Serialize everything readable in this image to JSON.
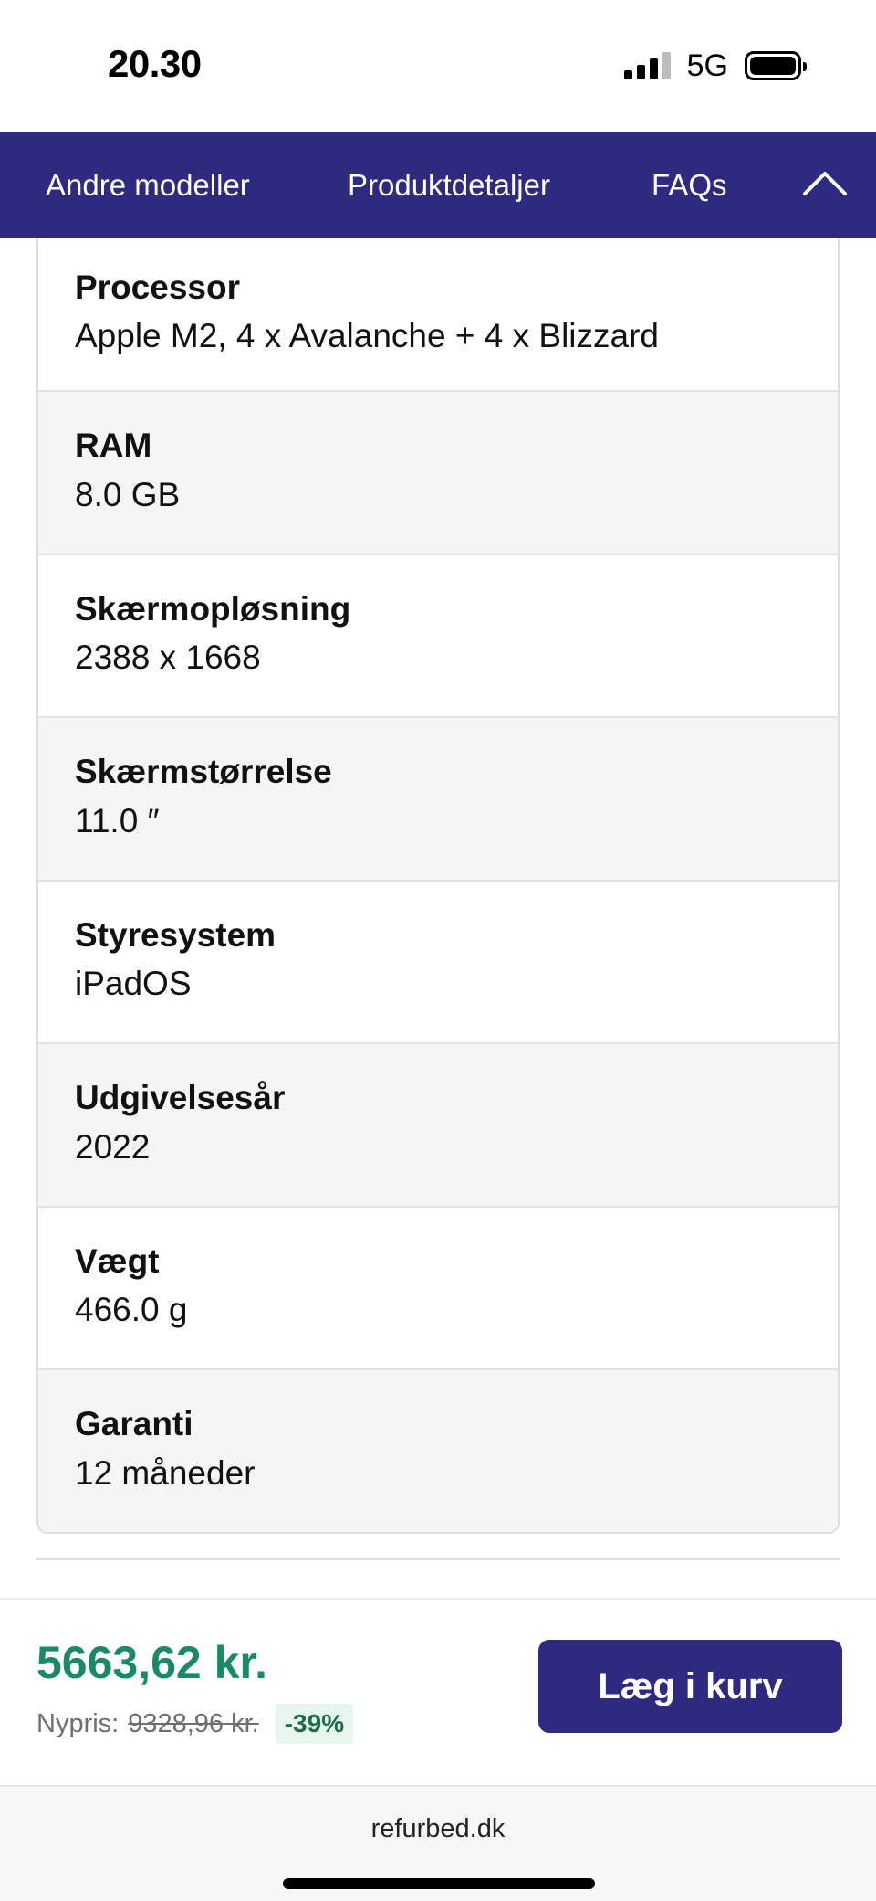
{
  "status_bar": {
    "time": "20.30",
    "network": "5G",
    "icons": [
      "signal-icon",
      "battery-icon"
    ]
  },
  "nav": {
    "items": [
      {
        "label": "Andre modeller"
      },
      {
        "label": "Produktdetaljer"
      },
      {
        "label": "FAQs"
      }
    ],
    "collapse_icon": "chevron-up-icon",
    "background": "#2e2a7f"
  },
  "specs": [
    {
      "label": "Processor",
      "value": "Apple M2, 4 x Avalanche + 4 x Blizzard"
    },
    {
      "label": "RAM",
      "value": "8.0 GB"
    },
    {
      "label": "Skærmopløsning",
      "value": "2388 x 1668"
    },
    {
      "label": "Skærmstørrelse",
      "value": "11.0 ″"
    },
    {
      "label": "Styresystem",
      "value": "iPadOS"
    },
    {
      "label": "Udgivelsesår",
      "value": "2022"
    },
    {
      "label": "Vægt",
      "value": "466.0 g"
    },
    {
      "label": "Garanti",
      "value": "12 måneder"
    }
  ],
  "buy_bar": {
    "price": "5663,62 kr.",
    "new_price_label": "Nypris:",
    "new_price_old": "9328,96 kr.",
    "discount": "-39%",
    "cart_button": "Læg i kurv",
    "price_color": "#1a8a64",
    "button_color": "#2e2a7f"
  },
  "browser": {
    "domain": "refurbed.dk"
  }
}
